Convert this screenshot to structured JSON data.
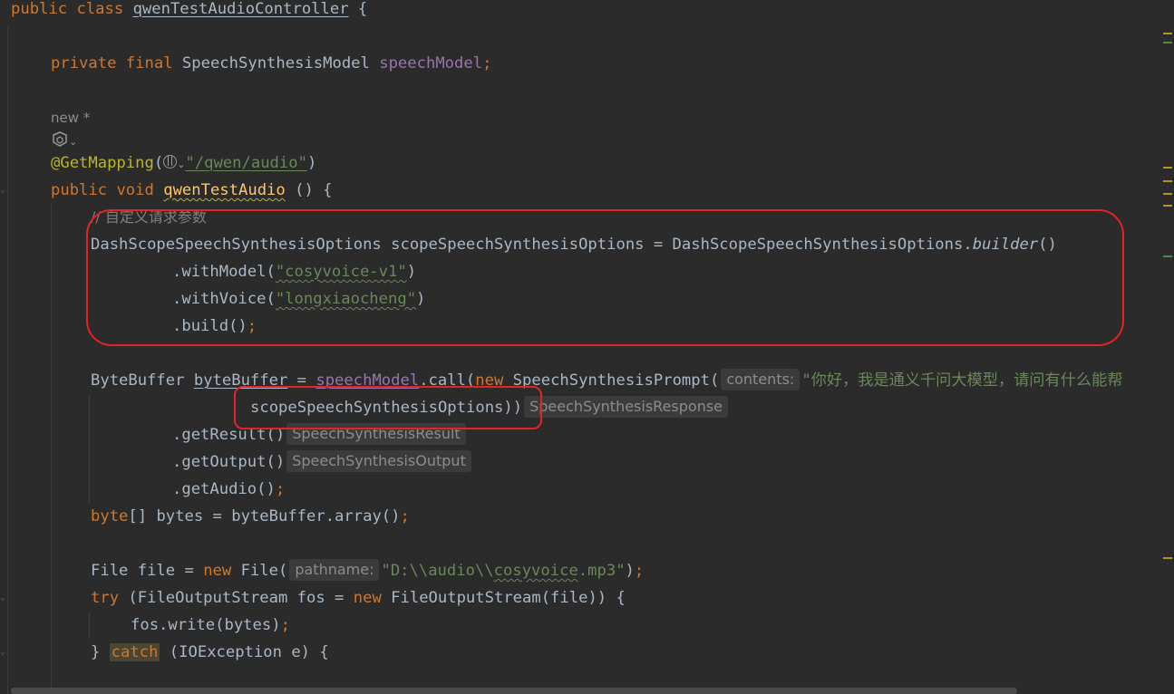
{
  "code": {
    "class_decl": {
      "kw1": "public",
      "kw2": "class",
      "name": "qwenTestAudioController",
      "brace": " {"
    },
    "field": {
      "kw1": "private",
      "kw2": "final",
      "type": "SpeechSynthesisModel",
      "name": "speechModel",
      "semi": ";"
    },
    "usages_hint": "new *",
    "annotation": {
      "name": "@GetMapping",
      "open": "(",
      "path": "\"/qwen/audio\"",
      "close": ")"
    },
    "method_decl": {
      "kw1": "public",
      "kw2": "void",
      "name": "qwenTestAudio",
      "rest": " () {"
    },
    "comment": "// 自定义请求参数",
    "options_line": {
      "type": "DashScopeSpeechSynthesisOptions",
      "var": " scopeSpeechSynthesisOptions = DashScopeSpeechSynthesisOptions.",
      "call": "builder",
      "tail": "()"
    },
    "with_model": {
      "pre": ".withModel(",
      "arg": "\"cosyvoice-v1\"",
      "post": ")"
    },
    "with_voice": {
      "pre": ".withVoice(",
      "arg": "\"longxiaocheng\"",
      "post": ")"
    },
    "build": {
      "pre": ".build()",
      "semi": ";"
    },
    "bytebuffer_line": {
      "pre": "ByteBuffer ",
      "var": "byteBuffer",
      "eq": " = ",
      "field": "speechModel",
      "call": ".call(",
      "kw_new": "new",
      "ctor": " SpeechSynthesisPrompt(",
      "hint": "contents:",
      "arg": "\"你好，我是通义千问大模型，请问有什么能帮"
    },
    "options_arg": {
      "text": "scopeSpeechSynthesisOptions))",
      "hint": "SpeechSynthesisResponse"
    },
    "get_result": {
      "text": ".getResult()",
      "hint": "SpeechSynthesisResult"
    },
    "get_output": {
      "text": ".getOutput()",
      "hint": "SpeechSynthesisOutput"
    },
    "get_audio": {
      "text": ".getAudio()",
      "semi": ";"
    },
    "bytes_line": {
      "kw": "byte",
      "rest": "[] bytes = byteBuffer.array()",
      "semi": ";"
    },
    "file_line": {
      "pre": "File file = ",
      "kw_new": "new",
      "ctor": " File(",
      "hint": "pathname:",
      "arg_a": "\"D:\\\\audio\\\\",
      "arg_b": "cosyvoice",
      "arg_c": ".mp3\"",
      "post": ")",
      "semi": ";"
    },
    "try_line": {
      "kw": "try",
      "mid": " (FileOutputStream fos = ",
      "kw_new": "new",
      "rest": " FileOutputStream(file)) {"
    },
    "write_line": {
      "text": "fos.write(bytes)",
      "semi": ";"
    },
    "catch_line": {
      "pre": "} ",
      "kw": "catch",
      "rest": " (IOException e) {"
    }
  },
  "icons": [
    "globe-icon",
    "chevron-down-icon",
    "ai-assistant-icon",
    "fold-marker-icon"
  ],
  "colors": {
    "background": "#2b2b2b",
    "keyword": "#cc7832",
    "string": "#6a8759",
    "field": "#9876aa",
    "method": "#ffc66d",
    "annotation": "#bbb529",
    "default": "#a9b7c6",
    "highlight_box": "#e22424"
  }
}
